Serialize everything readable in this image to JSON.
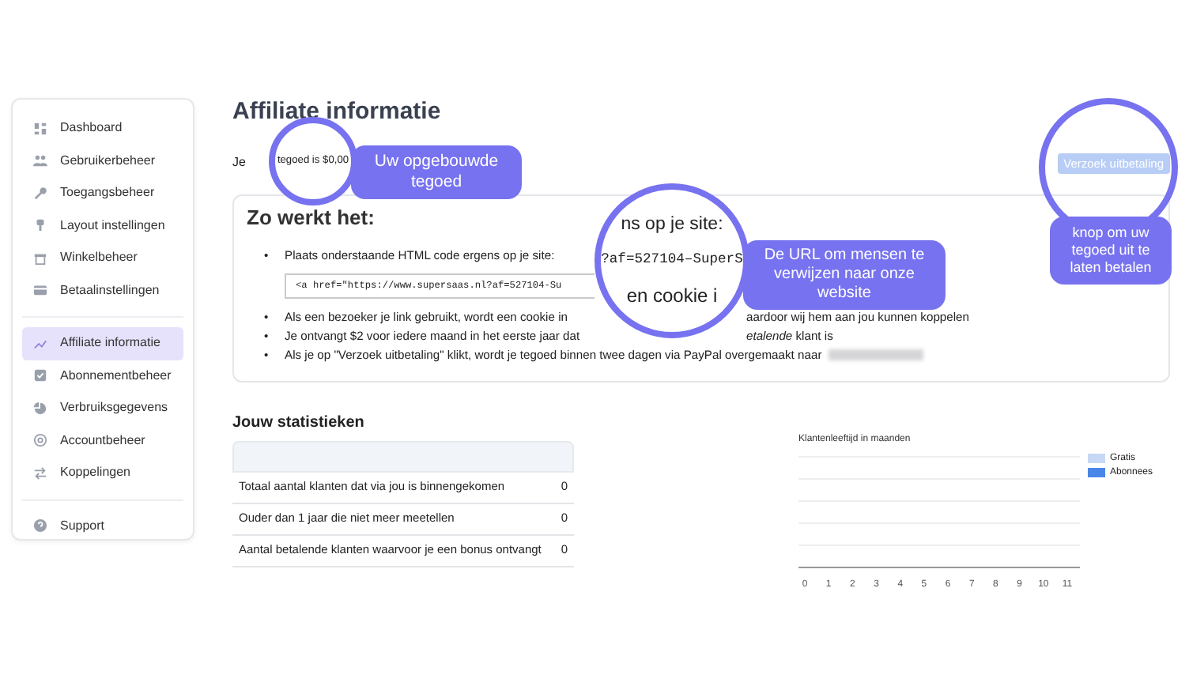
{
  "sidebar": {
    "groups": [
      {
        "items": [
          {
            "label": "Dashboard",
            "selected": false
          },
          {
            "label": "Gebruikerbeheer",
            "selected": false
          },
          {
            "label": "Toegangsbeheer",
            "selected": false
          },
          {
            "label": "Layout instellingen",
            "selected": false
          },
          {
            "label": "Winkelbeheer",
            "selected": false
          },
          {
            "label": "Betaalinstellingen",
            "selected": false
          }
        ]
      },
      {
        "items": [
          {
            "label": "Affiliate informatie",
            "selected": true
          },
          {
            "label": "Abonnementbeheer",
            "selected": false
          },
          {
            "label": "Verbruiksgegevens",
            "selected": false
          },
          {
            "label": "Accountbeheer",
            "selected": false
          },
          {
            "label": "Koppelingen",
            "selected": false
          }
        ]
      },
      {
        "items": [
          {
            "label": "Support",
            "selected": false
          }
        ]
      }
    ]
  },
  "title": "Affiliate informatie",
  "balance_prefix": "Je",
  "payout_button": {
    "label": "Verzoek uitbetaling"
  },
  "how_it_works": {
    "heading": "Zo werkt het:",
    "bullets": [
      {
        "marker": "•",
        "text": "Plaats onderstaande HTML code ergens op je site:"
      },
      {
        "marker": "•",
        "text": "Als een bezoeker je link gebruikt, wordt een cookie in",
        "continuation": "aardoor wij hem aan jou kunnen koppelen"
      },
      {
        "marker": "•",
        "text": "Je ontvangt $2 voor iedere maand in het eerste jaar dat",
        "continuation": "*etalende* klant is"
      },
      {
        "marker": "•",
        "text": "Als je op \"Verzoek uitbetaling\" klikt, wordt je tegoed binnen twee dagen via PayPal overgemaakt naar",
        "redacted": true
      }
    ],
    "code_field": {
      "value": "<a href=\"https://www.supersaas.nl?af=527104-Su"
    }
  },
  "statistics": {
    "heading": "Jouw statistieken",
    "rows": [
      {
        "label": "Totaal aantal klanten dat via jou is binnengekomen",
        "value": "0"
      },
      {
        "label": "Ouder dan 1 jaar die niet meer meetellen",
        "value": "0"
      },
      {
        "label": "Aantal betalende klanten waarvoor je een bonus ontvangt",
        "value": "0"
      }
    ]
  },
  "chart": {
    "title": "Klantenleeftijd in maanden",
    "legend": [
      {
        "label": "Gratis",
        "color": "#c6d8f6"
      },
      {
        "label": "Abonnees",
        "color": "#4a86e8"
      }
    ],
    "x_labels": [
      "0",
      "1",
      "2",
      "3",
      "4",
      "5",
      "6",
      "7",
      "8",
      "9",
      "10",
      "11"
    ]
  },
  "annotations": [
    {
      "kind": "magnifier",
      "texts": [
        "tegoed is $0,00"
      ]
    },
    {
      "kind": "callout",
      "text": "Uw opgebouwde tegoed"
    },
    {
      "kind": "magnifier",
      "texts": [
        "ns op je site:",
        "?af=527104–SuperS",
        "en cookie i"
      ]
    },
    {
      "kind": "callout",
      "text": "De URL om mensen te verwijzen naar onze website"
    },
    {
      "kind": "ring"
    },
    {
      "kind": "callout",
      "text": "knop om uw tegoed uit te laten betalen"
    }
  ]
}
